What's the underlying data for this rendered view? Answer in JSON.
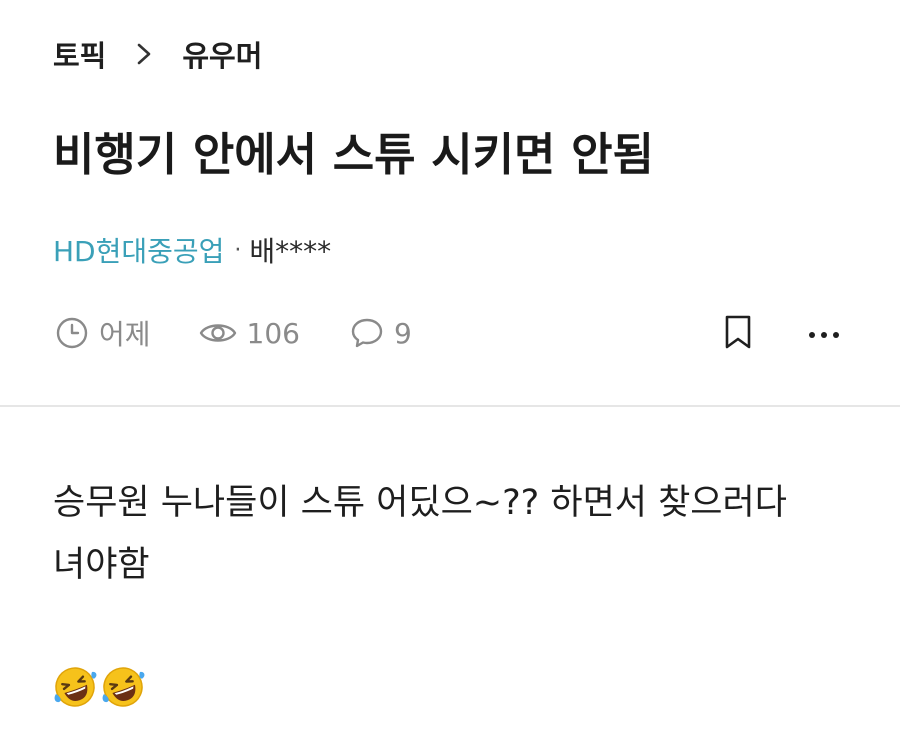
{
  "breadcrumb": {
    "topic": "토픽",
    "category": "유우머"
  },
  "post": {
    "title": "비행기 안에서 스튜 시키면 안됨",
    "company": "HD현대중공업",
    "separator": "·",
    "author": "배****",
    "time": "어제",
    "views": "106",
    "comments": "9",
    "body_line1": "승무원 누나들이 스튜 어딨으~?? 하면서 찾으러다",
    "body_line2": "녀야함",
    "emojis": [
      "rolling-on-floor-laughing",
      "rolling-on-floor-laughing"
    ]
  },
  "colors": {
    "company_link": "#3aa0b8",
    "stat_gray": "#8a8a8a",
    "divider": "#e6e6e6"
  },
  "icons": {
    "time": "clock-icon",
    "views": "eye-icon",
    "comments": "speech-bubble-icon",
    "bookmark": "bookmark-icon",
    "more": "more-dots-icon",
    "breadcrumb_sep": "chevron-right-icon"
  }
}
